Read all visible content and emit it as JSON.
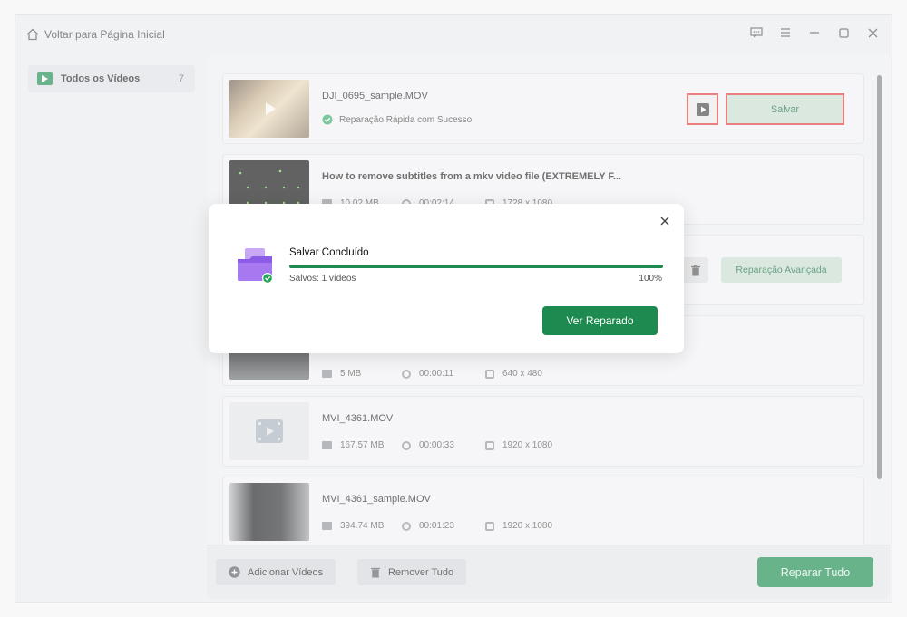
{
  "titlebar": {
    "home_label": "Voltar para Página Inicial",
    "controls": [
      "feedback-icon",
      "menu-icon",
      "minimize-icon",
      "maximize-icon",
      "close-icon"
    ]
  },
  "sidebar": {
    "items": [
      {
        "label": "Todos os Vídeos",
        "count": "7"
      }
    ]
  },
  "videos": [
    {
      "name": "DJI_0695_sample.MOV",
      "status": "Reparação Rápida com Sucesso",
      "save_label": "Salvar"
    },
    {
      "name": "How to remove subtitles from a mkv video file (EXTREMELY F...",
      "size": "10.02 MB",
      "duration": "00:02:14",
      "resolution": "1728 x 1080"
    },
    {
      "advanced_label": "Reparação Avançada"
    },
    {
      "size": "5 MB",
      "duration": "00:00:11",
      "resolution": "640 x 480"
    },
    {
      "name": "MVI_4361.MOV",
      "size": "167.57 MB",
      "duration": "00:00:33",
      "resolution": "1920 x 1080"
    },
    {
      "name": "MVI_4361_sample.MOV",
      "size": "394.74 MB",
      "duration": "00:01:23",
      "resolution": "1920 x 1080"
    }
  ],
  "bottombar": {
    "add_label": "Adicionar Vídeos",
    "remove_label": "Remover Tudo",
    "repair_all_label": "Reparar Tudo"
  },
  "dialog": {
    "title": "Salvar Concluído",
    "saved_text": "Salvos: 1 vídeos",
    "percent_text": "100%",
    "progress": 1.0,
    "view_button": "Ver Reparado"
  },
  "colors": {
    "accent": "#1d8b4f",
    "highlight": "#e03a3a"
  }
}
